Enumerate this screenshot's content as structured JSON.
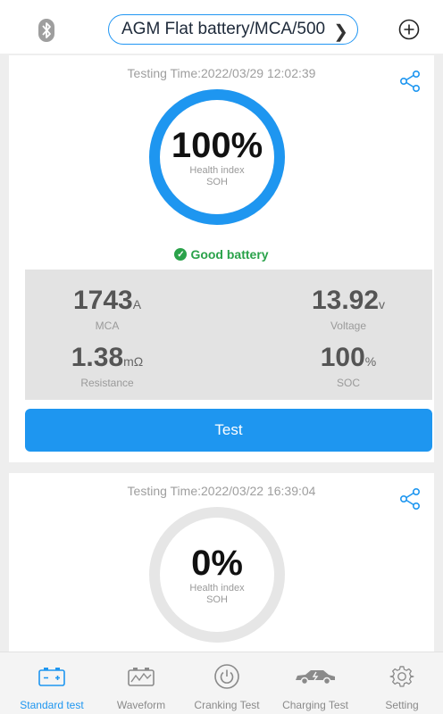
{
  "header": {
    "battery_preset": "AGM Flat battery/MCA/500"
  },
  "current_result": {
    "testing_time": "Testing Time:2022/03/29 12:02:39",
    "health_percent": "100%",
    "health_label": "Health index",
    "soh_label": "SOH",
    "health_fraction": 1.0,
    "status": "Good battery",
    "metrics": {
      "mca_value": "1743",
      "mca_unit": "A",
      "mca_label": "MCA",
      "voltage_value": "13.92",
      "voltage_unit": "v",
      "voltage_label": "Voltage",
      "resistance_value": "1.38",
      "resistance_unit": "mΩ",
      "resistance_label": "Resistance",
      "soc_value": "100",
      "soc_unit": "%",
      "soc_label": "SOC"
    },
    "test_button": "Test"
  },
  "previous_result": {
    "testing_time": "Testing Time:2022/03/22 16:39:04",
    "health_percent": "0%",
    "health_label": "Health index",
    "soh_label": "SOH",
    "health_fraction": 0.0
  },
  "nav": {
    "items": [
      {
        "label": "Standard test",
        "icon": "battery-icon",
        "active": true
      },
      {
        "label": "Waveform",
        "icon": "waveform-icon",
        "active": false
      },
      {
        "label": "Cranking Test",
        "icon": "power-icon",
        "active": false
      },
      {
        "label": "Charging Test",
        "icon": "car-charging-icon",
        "active": false
      },
      {
        "label": "Setting",
        "icon": "gear-icon",
        "active": false
      }
    ]
  },
  "colors": {
    "accent": "#1e96f0",
    "good": "#2aa24a",
    "ring_empty": "#e6e6e6"
  }
}
